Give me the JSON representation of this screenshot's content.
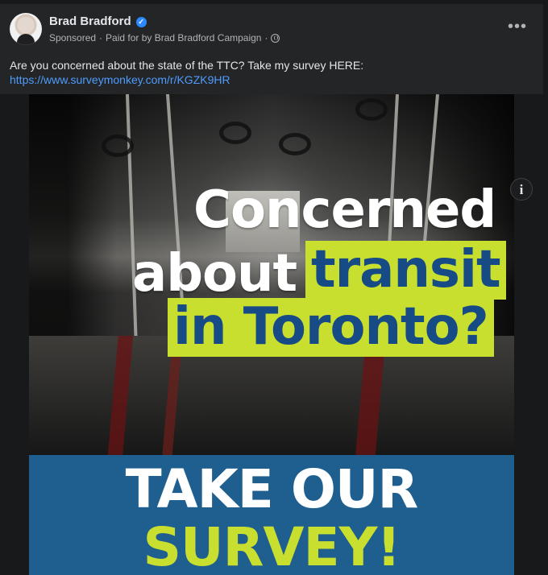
{
  "post": {
    "author": "Brad Bradford",
    "verified_icon": "verified-badge-icon",
    "meta": {
      "sponsored": "Sponsored",
      "separator": "·",
      "paid_for": "Paid for by Brad Bradford Campaign",
      "visibility_separator": "·",
      "visibility_icon": "globe-icon"
    },
    "more_icon": "more-options-icon",
    "caption": "Are you concerned about the state of the TTC? Take my survey HERE:",
    "link": "https://www.surveymonkey.com/r/KGZK9HR"
  },
  "ad": {
    "headline_line_1": "Concerned",
    "headline_line_2": "about",
    "headline_line_3": "transit",
    "headline_line_4": "in Toronto?",
    "banner_line_1": "TAKE OUR",
    "banner_line_2": "SURVEY!",
    "info_label": "i",
    "colors": {
      "highlight": "#c9df30",
      "blue": "#1f5f8f",
      "link": "#4f9cff"
    }
  }
}
